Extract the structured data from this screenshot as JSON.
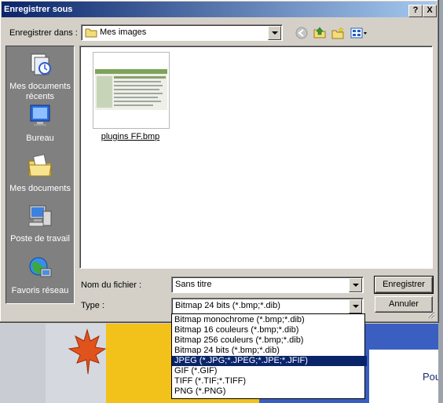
{
  "background": {
    "partial_text": "Pou"
  },
  "dialog": {
    "title": "Enregistrer sous",
    "help_label": "?",
    "close_label": "X",
    "save_in_label": "Enregistrer dans :",
    "save_in_value": "Mes images",
    "places": [
      {
        "label": "Mes documents récents",
        "icon": "recent-documents-icon"
      },
      {
        "label": "Bureau",
        "icon": "desktop-icon"
      },
      {
        "label": "Mes documents",
        "icon": "my-documents-icon"
      },
      {
        "label": "Poste de travail",
        "icon": "my-computer-icon"
      },
      {
        "label": "Favoris réseau",
        "icon": "network-places-icon"
      }
    ],
    "files": [
      {
        "name": "plugins FF.bmp"
      }
    ],
    "filename_label": "Nom du fichier :",
    "filename_value": "Sans titre",
    "type_label": "Type :",
    "type_value": "Bitmap 24 bits (*.bmp;*.dib)",
    "save_button": "Enregistrer",
    "cancel_button": "Annuler",
    "type_options": [
      "Bitmap monochrome (*.bmp;*.dib)",
      "Bitmap 16 couleurs (*.bmp;*.dib)",
      "Bitmap 256 couleurs (*.bmp;*.dib)",
      "Bitmap 24 bits (*.bmp;*.dib)",
      "JPEG (*.JPG;*.JPEG;*.JPE;*.JFIF)",
      "GIF (*.GIF)",
      "TIFF (*.TIF;*.TIFF)",
      "PNG (*.PNG)"
    ],
    "selected_option_index": 4
  },
  "colors": {
    "titlebar_start": "#0a246a",
    "titlebar_end": "#a6caf0",
    "selection": "#0a246a",
    "face": "#d4d0c8"
  }
}
